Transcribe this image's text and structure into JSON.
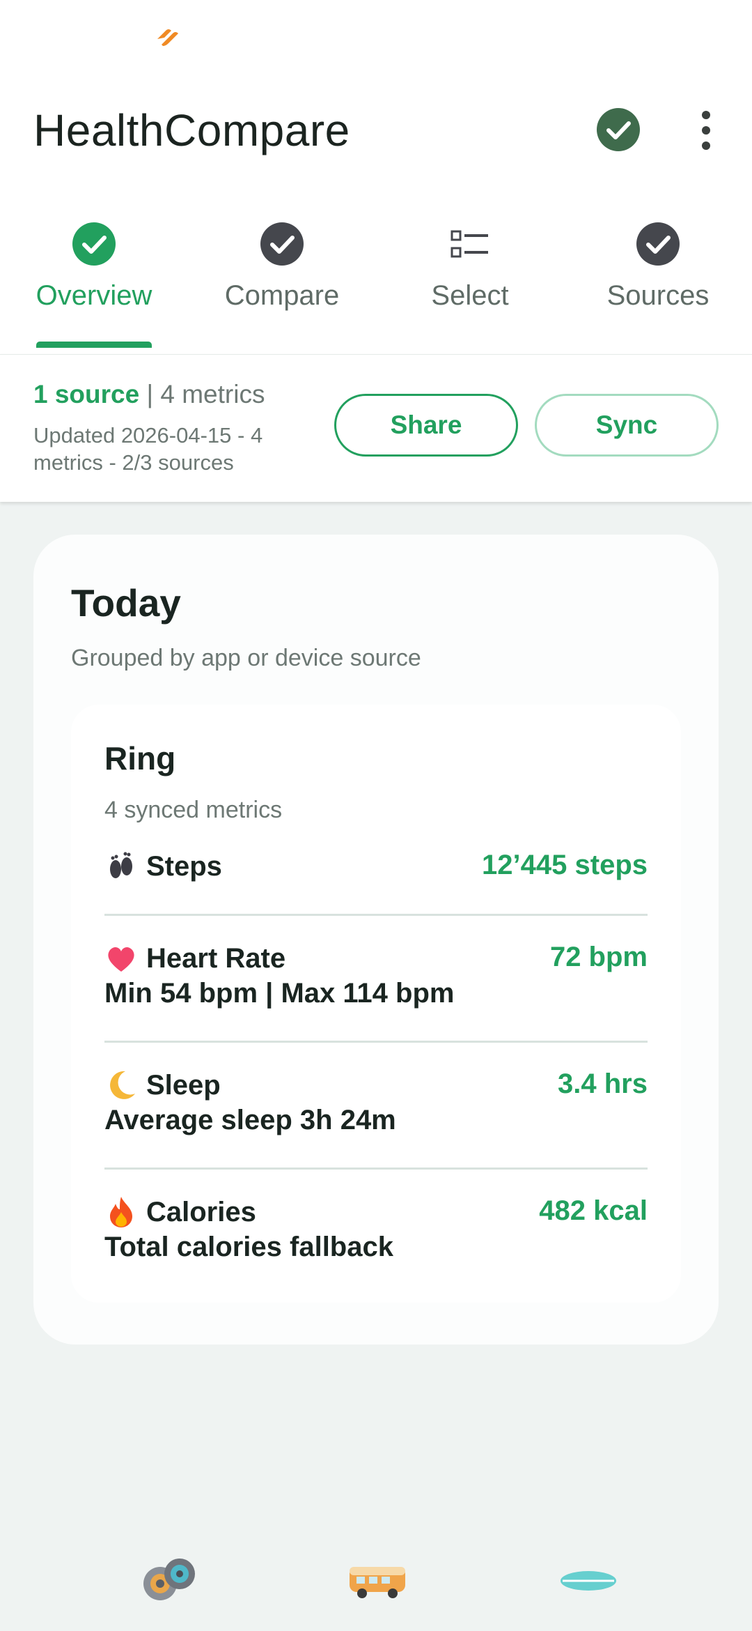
{
  "app": {
    "title": "HealthCompare"
  },
  "icons": {
    "notification": "orange-app-notification-icon",
    "status": "check-circle-icon",
    "overflow": "more-vert-icon"
  },
  "tabs": [
    {
      "label": "Overview",
      "icon": "check-circle-icon",
      "active": true
    },
    {
      "label": "Compare",
      "icon": "check-circle-icon",
      "active": false
    },
    {
      "label": "Select",
      "icon": "checklist-icon",
      "active": false
    },
    {
      "label": "Sources",
      "icon": "check-circle-icon",
      "active": false
    }
  ],
  "summary": {
    "sources": "1 source",
    "separator": " | ",
    "metrics": "4 metrics",
    "updated": "Updated 2026-04-15 - 4 metrics - 2/3 sources",
    "share_label": "Share",
    "sync_label": "Sync"
  },
  "today": {
    "title": "Today",
    "subtitle": "Grouped by app or device source",
    "source": {
      "name": "Ring",
      "subtitle": "4 synced metrics",
      "metrics": [
        {
          "icon": "footprints-icon",
          "name": "Steps",
          "value": "12’445 steps",
          "detail": ""
        },
        {
          "icon": "heart-icon",
          "name": "Heart Rate",
          "value": "72 bpm",
          "detail": "Min 54 bpm | Max 114 bpm"
        },
        {
          "icon": "moon-icon",
          "name": "Sleep",
          "value": "3.4 hrs",
          "detail": "Average sleep 3h 24m"
        },
        {
          "icon": "fire-icon",
          "name": "Calories",
          "value": "482 kcal",
          "detail": "Total calories fallback"
        }
      ]
    }
  },
  "bottom_icons": [
    "film-reels-icon",
    "camper-van-icon",
    "surfboard-icon"
  ],
  "colors": {
    "accent": "#22a05e",
    "status_badge": "#3f6b4c",
    "inactive_icon": "#45474d",
    "background": "#eff3f2"
  }
}
